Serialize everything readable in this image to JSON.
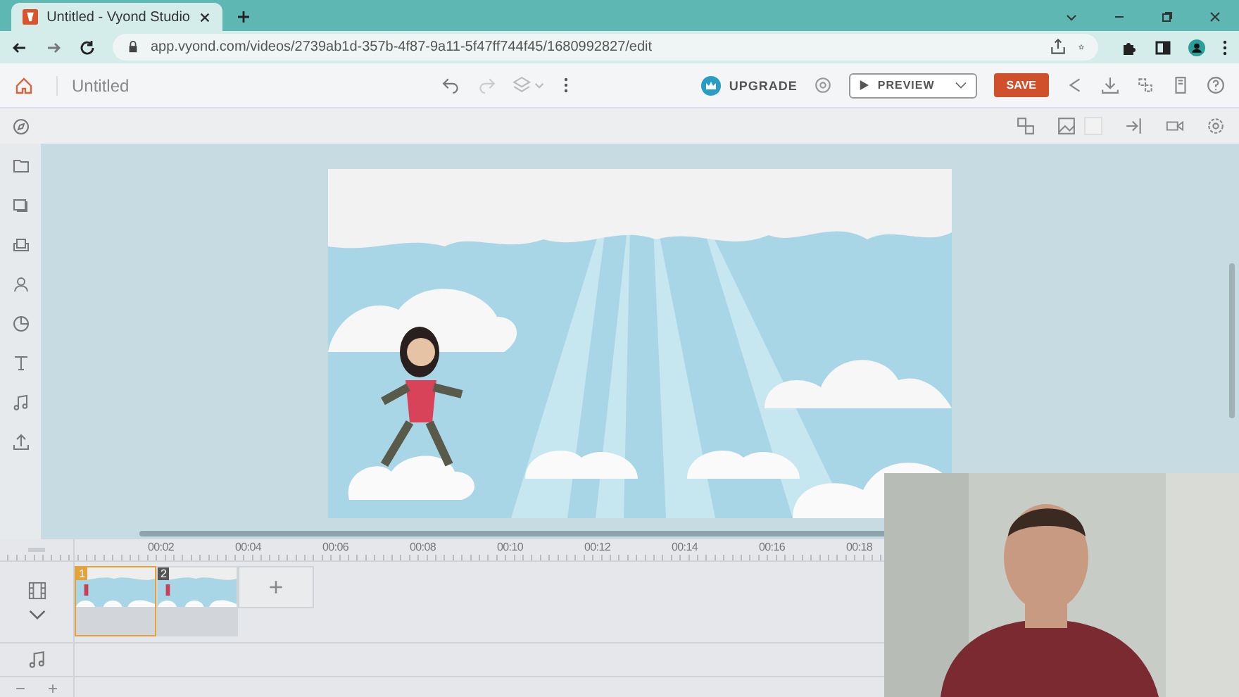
{
  "browser": {
    "tab_title": "Untitled - Vyond Studio",
    "url": "app.vyond.com/videos/2739ab1d-357b-4f87-9a11-5f47ff744f45/1680992827/edit"
  },
  "toolbar": {
    "title": "Untitled",
    "upgrade": "UPGRADE",
    "preview": "PREVIEW",
    "save": "SAVE"
  },
  "timeline": {
    "ticks": [
      "00:02",
      "00:04",
      "00:06",
      "00:08",
      "00:10",
      "00:12",
      "00:14",
      "00:16",
      "00:18"
    ],
    "scenes": [
      {
        "number": "1",
        "selected": true
      },
      {
        "number": "2",
        "selected": false
      }
    ],
    "add_scene": "+",
    "zoom_out": "−",
    "zoom_in": "+"
  }
}
